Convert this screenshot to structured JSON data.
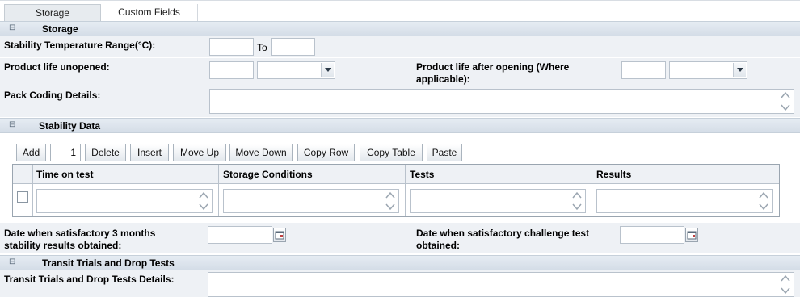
{
  "tabs": [
    {
      "label": "Storage",
      "active": true
    },
    {
      "label": "Custom Fields",
      "active": false
    }
  ],
  "storage": {
    "title": "Storage",
    "temp_range_label": "Stability Temperature Range(°C):",
    "to_label": "To",
    "life_unopened_label": "Product life unopened:",
    "life_after_opening_label_1": "Product life after opening (Where",
    "life_after_opening_label_2": "applicable):",
    "pack_coding_label": "Pack Coding Details:"
  },
  "stability": {
    "title": "Stability Data",
    "toolbar": {
      "add": "Add",
      "count": "1",
      "delete": "Delete",
      "insert": "Insert",
      "move_up": "Move Up",
      "move_down": "Move Down",
      "copy_row": "Copy Row",
      "copy_table": "Copy Table",
      "paste": "Paste"
    },
    "columns": [
      "Time on test",
      "Storage Conditions",
      "Tests",
      "Results"
    ],
    "date_3m_label_1": "Date when satisfactory 3 months",
    "date_3m_label_2": "stability results obtained:",
    "date_challenge_label_1": "Date when satisfactory challenge test",
    "date_challenge_label_2": "obtained:"
  },
  "transit": {
    "title": "Transit Trials and Drop Tests",
    "details_label": "Transit Trials and Drop Tests Details:"
  },
  "colors": {
    "section_header": "#dbe3ec",
    "row_band": "#eef1f5",
    "border": "#b9c2cc"
  }
}
